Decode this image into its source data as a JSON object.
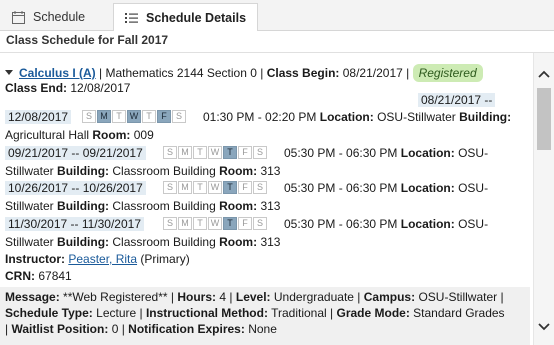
{
  "tabs": [
    {
      "label": "Schedule",
      "icon": "calendar-icon"
    },
    {
      "label": "Schedule Details",
      "icon": "list-icon"
    }
  ],
  "header": {
    "title": "Class Schedule for Fall 2017"
  },
  "course": {
    "name": "Calculus I (A)",
    "sep1": " | ",
    "subject_section": "Mathematics 2144 Section 0",
    "sep2": " | ",
    "class_begin_label": "Class Begin:",
    "class_begin": "08/21/2017",
    "sep3": " | ",
    "status": "Registered",
    "class_end_label": "Class End:",
    "class_end": "12/08/2017"
  },
  "meetings": [
    {
      "date_start": "08/21/2017 --",
      "date_end": "12/08/2017",
      "days": [
        {
          "d": "S",
          "on": false
        },
        {
          "d": "M",
          "on": true
        },
        {
          "d": "T",
          "on": false
        },
        {
          "d": "W",
          "on": true
        },
        {
          "d": "T",
          "on": false
        },
        {
          "d": "F",
          "on": true
        },
        {
          "d": "S",
          "on": false
        }
      ],
      "time": "01:30 PM - 02:20 PM",
      "location_label": "Location:",
      "location": "OSU-Stillwater",
      "building_label": "Building:",
      "building": "Agricultural Hall",
      "room_label": "Room:",
      "room": "009"
    },
    {
      "date_range": "09/21/2017 -- 09/21/2017",
      "days": [
        {
          "d": "S",
          "on": false
        },
        {
          "d": "M",
          "on": false
        },
        {
          "d": "T",
          "on": false
        },
        {
          "d": "W",
          "on": false
        },
        {
          "d": "T",
          "on": true
        },
        {
          "d": "F",
          "on": false
        },
        {
          "d": "S",
          "on": false
        }
      ],
      "time": "05:30 PM - 06:30 PM",
      "location_label": "Location:",
      "location_part1": "OSU-",
      "location_part2": "Stillwater",
      "building_label": "Building:",
      "building": "Classroom Building",
      "room_label": "Room:",
      "room": "313"
    },
    {
      "date_range": "10/26/2017 -- 10/26/2017",
      "days": [
        {
          "d": "S",
          "on": false
        },
        {
          "d": "M",
          "on": false
        },
        {
          "d": "T",
          "on": false
        },
        {
          "d": "W",
          "on": false
        },
        {
          "d": "T",
          "on": true
        },
        {
          "d": "F",
          "on": false
        },
        {
          "d": "S",
          "on": false
        }
      ],
      "time": "05:30 PM - 06:30 PM",
      "location_label": "Location:",
      "location_part1": "OSU-",
      "location_part2": "Stillwater",
      "building_label": "Building:",
      "building": "Classroom Building",
      "room_label": "Room:",
      "room": "313"
    },
    {
      "date_range": "11/30/2017 -- 11/30/2017",
      "days": [
        {
          "d": "S",
          "on": false
        },
        {
          "d": "M",
          "on": false
        },
        {
          "d": "T",
          "on": false
        },
        {
          "d": "W",
          "on": false
        },
        {
          "d": "T",
          "on": true
        },
        {
          "d": "F",
          "on": false
        },
        {
          "d": "S",
          "on": false
        }
      ],
      "time": "05:30 PM - 06:30 PM",
      "location_label": "Location:",
      "location_part1": "OSU-",
      "location_part2": "Stillwater",
      "building_label": "Building:",
      "building": "Classroom Building",
      "room_label": "Room:",
      "room": "313"
    }
  ],
  "instructor": {
    "label": "Instructor:",
    "name": "Peaster, Rita",
    "role": " (Primary)"
  },
  "crn": {
    "label": "CRN:",
    "value": "67841"
  },
  "details": {
    "message_label": "Message:",
    "message": "**Web Registered**",
    "hours_label": "Hours:",
    "hours": "4",
    "level_label": "Level:",
    "level": "Undergraduate",
    "campus_label": "Campus:",
    "campus": "OSU-Stillwater",
    "schedule_type_label": "Schedule Type:",
    "schedule_type": "Lecture",
    "method_label": "Instructional Method:",
    "method": "Traditional",
    "grade_mode_label": "Grade Mode:",
    "grade_mode": "Standard Grades",
    "waitlist_label": "Waitlist Position:",
    "waitlist": "0",
    "notif_label": "Notification Expires:",
    "notif": "None",
    "sep": " | "
  },
  "colors": {
    "accent_link": "#1a5a9a",
    "registered_bg": "#cdebb4",
    "day_on": "#8aa6bc",
    "date_hl": "#e3ecf3"
  }
}
